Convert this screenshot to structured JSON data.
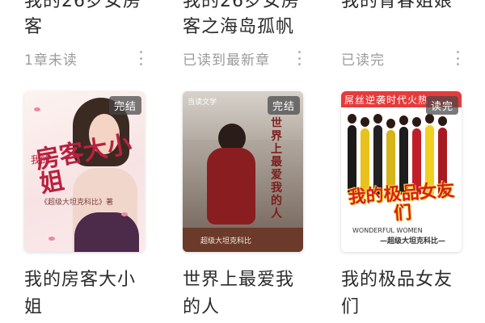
{
  "shelf": {
    "top_row": [
      {
        "title": "我的26岁女房客",
        "status": "1章未读"
      },
      {
        "title": "我的26岁女房客之海岛孤帆",
        "status": "已读到最新章"
      },
      {
        "title": "我的青春姐娘",
        "status": "已读完"
      }
    ],
    "bottom_row": [
      {
        "title": "我的房客大小姐",
        "badge": "完结",
        "cover": {
          "title_big": "房客大小姐",
          "title_small": "我的",
          "author": "《超级大坦克科比》著"
        }
      },
      {
        "title": "世界上最爱我的人",
        "badge": "完结",
        "cover": {
          "publisher": "当读文学",
          "title": "世界上最爱我的人",
          "author": "超级大坦克科比"
        }
      },
      {
        "title": "我的极品女友们",
        "badge": "读完",
        "cover": {
          "banner": "屌丝逆袭时代火热",
          "title": "我的极品女友们",
          "tag": "WONDERFUL WOMEN",
          "author": "—超级大坦克科比—"
        }
      }
    ]
  },
  "colors": {
    "status_gray": "#9a9a9a",
    "title_dark": "#2b2b2b",
    "badge_bg": "#5a5a5a",
    "accent_red": "#e63b3b"
  },
  "icons": {
    "more": "more-vertical-icon"
  }
}
